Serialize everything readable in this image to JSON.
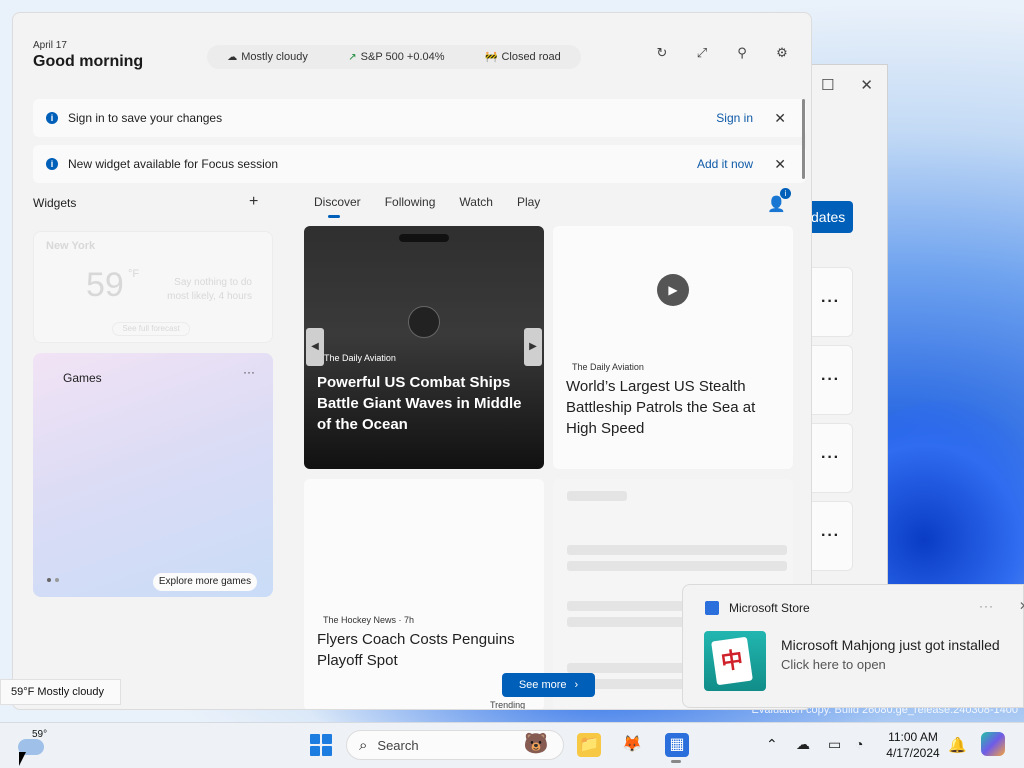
{
  "greeting": {
    "date": "April 17",
    "title": "Good morning"
  },
  "pills": [
    {
      "icon": "partly-cloudy-icon",
      "glyph": "☁",
      "label": "Mostly cloudy"
    },
    {
      "icon": "stock-chart-icon",
      "glyph": "↗",
      "label": "S&P 500 +0.04%"
    },
    {
      "icon": "traffic-icon",
      "glyph": "🚧",
      "label": "Closed road"
    }
  ],
  "banners": [
    {
      "text": "Sign in to save your changes",
      "action": "Sign in"
    },
    {
      "text": "New widget available for Focus session",
      "action": "Add it now"
    }
  ],
  "widgets": {
    "label": "Widgets",
    "weather": {
      "location": "New York",
      "temp": "59",
      "unit": "°F",
      "desc": "Say nothing to do most likely, 4 hours",
      "link": "See full forecast"
    },
    "games": {
      "title": "Games",
      "explore": "Explore more games"
    }
  },
  "tabs": [
    "Discover",
    "Following",
    "Watch",
    "Play"
  ],
  "news": [
    {
      "source": "The Daily Aviation",
      "headline": "Powerful US Combat Ships Battle Giant Waves in Middle of the Ocean"
    },
    {
      "source": "The Daily Aviation",
      "headline": "World’s Largest US Stealth Battleship Patrols the Sea at High Speed"
    },
    {
      "source": "The Hockey News · 7h",
      "headline": "Flyers Coach Costs Penguins Playoff Spot"
    }
  ],
  "see_more": "See more",
  "trending": "Trending",
  "tooltip": "59°F Mostly cloudy",
  "toast": {
    "app": "Microsoft Store",
    "message": "Microsoft Mahjong just got installed",
    "sub": "Click here to open",
    "tile_glyph": "中"
  },
  "bg_window": {
    "update_label": "dates"
  },
  "taskbar": {
    "weather_temp": "59°",
    "search_placeholder": "Search",
    "time": "11:00 AM",
    "date": "4/17/2024"
  },
  "watermark": "Evaluation copy. Build 26080.ge_release.240308-1400",
  "colors": {
    "accent": "#005fb8",
    "board_bg": "#f3f3f3",
    "taskbar_bg": "#eef2f7"
  }
}
